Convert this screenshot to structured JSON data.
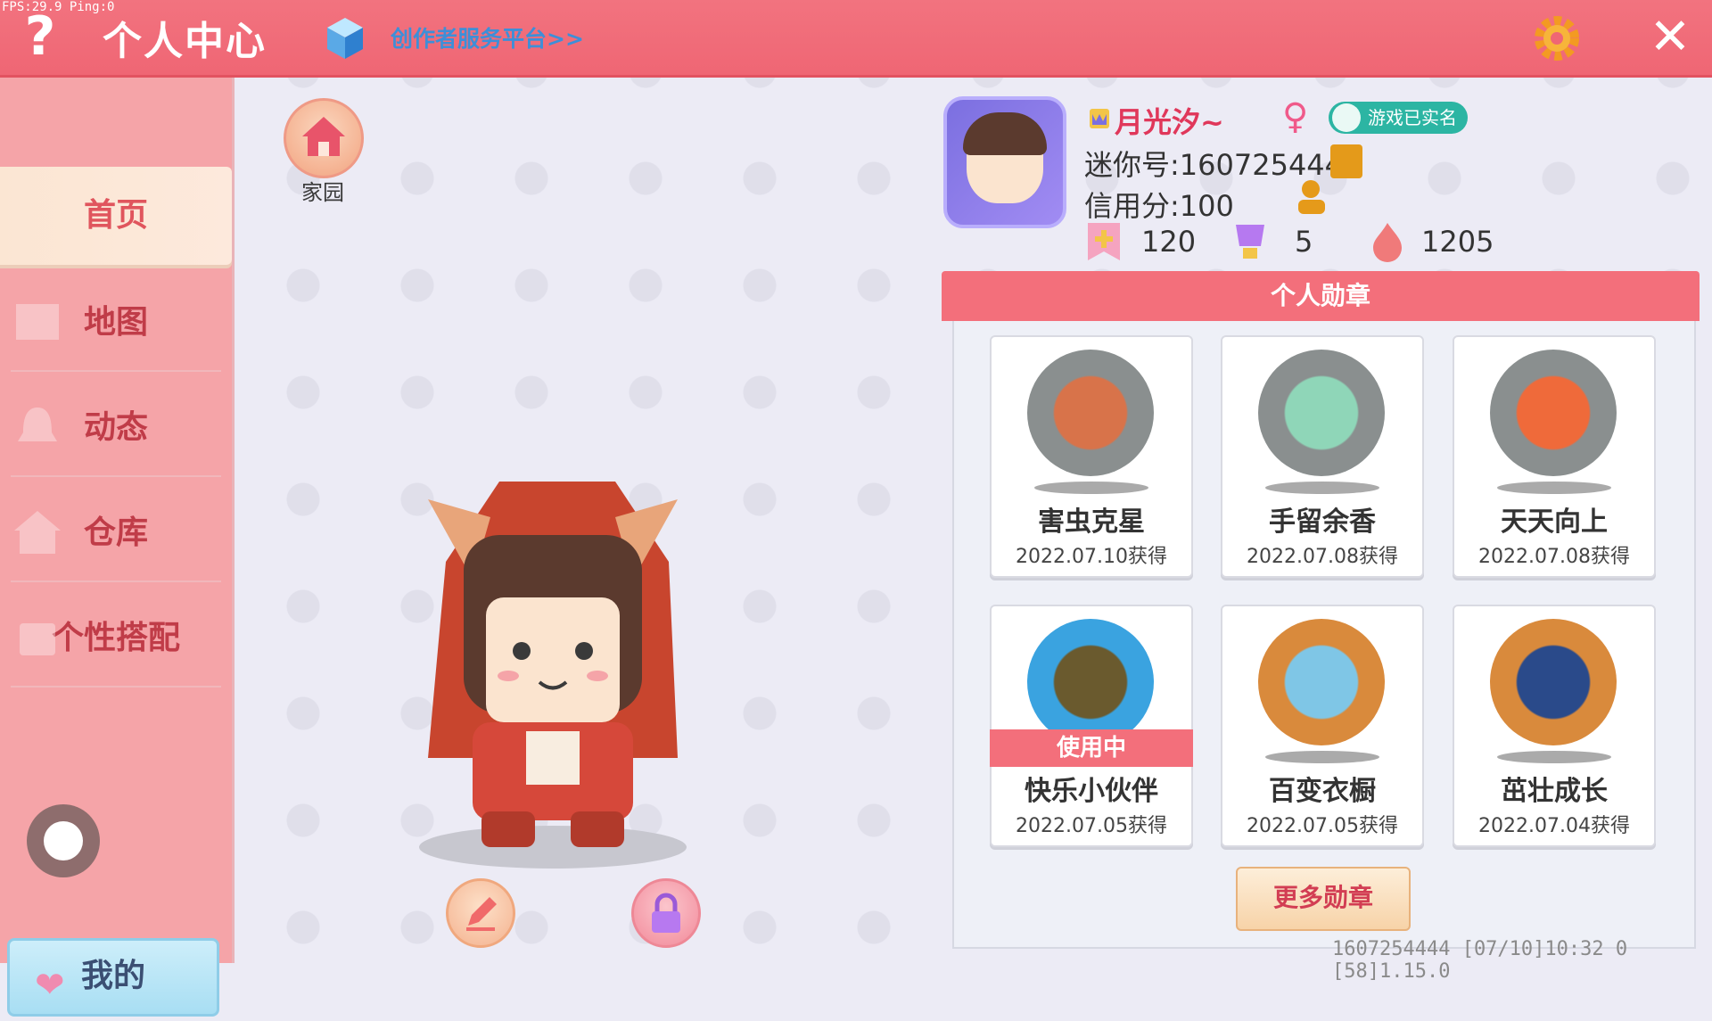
{
  "debug": {
    "fps_text": "FPS:29.9  Ping:0"
  },
  "header": {
    "title": "个人中心",
    "creator_link": "创作者服务平台>>"
  },
  "sidebar": {
    "items": [
      {
        "label": "首页",
        "active": true
      },
      {
        "label": "地图",
        "active": false
      },
      {
        "label": "动态",
        "active": false
      },
      {
        "label": "仓库",
        "active": false
      },
      {
        "label": "个性搭配",
        "active": false
      }
    ],
    "mine_label": "我的"
  },
  "home": {
    "label": "家园"
  },
  "profile": {
    "username": "月光汐~",
    "realname_badge": "游戏已实名",
    "mini_id": "迷你号:1607254444",
    "credit": "信用分:100",
    "stats": [
      "120",
      "5",
      "1205"
    ]
  },
  "medals": {
    "title": "个人勋章",
    "in_use_label": "使用中",
    "more_label": "更多勋章",
    "items": [
      {
        "name": "害虫克星",
        "date": "2022.07.10获得",
        "color": "#8a8f8f"
      },
      {
        "name": "手留余香",
        "date": "2022.07.08获得",
        "color": "#8a8f8f"
      },
      {
        "name": "天天向上",
        "date": "2022.07.08获得",
        "color": "#8a8f8f"
      },
      {
        "name": "快乐小伙伴",
        "date": "2022.07.05获得",
        "color": "#3aa3e0"
      },
      {
        "name": "百变衣橱",
        "date": "2022.07.05获得",
        "color": "#d98a3c"
      },
      {
        "name": "茁壮成长",
        "date": "2022.07.04获得",
        "color": "#d98a3c"
      }
    ]
  },
  "footer": {
    "info": "1607254444   [07/10]10:32 0  [58]1.15.0"
  },
  "colors": {
    "accent": "#f36f7b",
    "sidebar": "#f5a4a8",
    "realname": "#2cb5a3"
  }
}
